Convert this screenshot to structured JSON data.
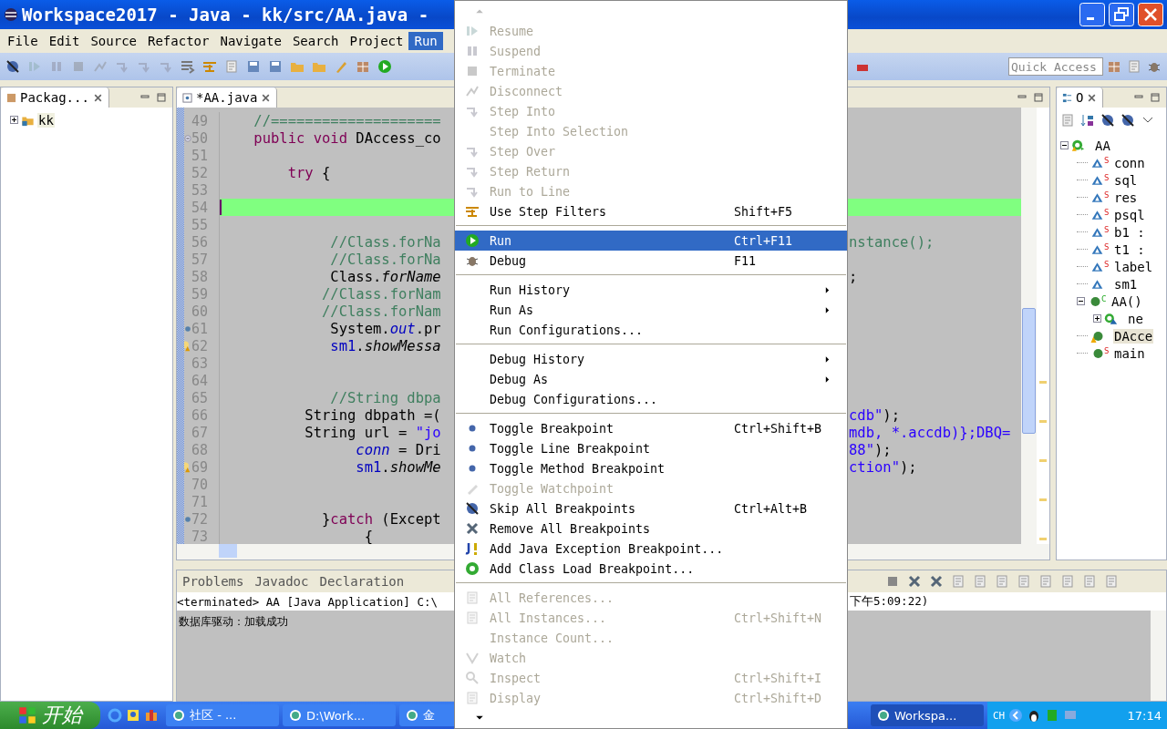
{
  "window": {
    "title": "Workspace2017 - Java - kk/src/AA.java -"
  },
  "menubar": [
    {
      "label": "File",
      "selected": false
    },
    {
      "label": "Edit",
      "selected": false
    },
    {
      "label": "Source",
      "selected": false
    },
    {
      "label": "Refactor",
      "selected": false
    },
    {
      "label": "Navigate",
      "selected": false
    },
    {
      "label": "Search",
      "selected": false
    },
    {
      "label": "Project",
      "selected": false
    },
    {
      "label": "Run",
      "selected": true
    }
  ],
  "toolbar": {
    "quick_access": {
      "placeholder": "Quick Access"
    }
  },
  "package_explorer": {
    "tab": {
      "label": "Packag..."
    },
    "tree": [
      {
        "label": "kk",
        "expanded": false,
        "selected": true
      }
    ]
  },
  "editor": {
    "tab": {
      "label": "*AA.java"
    },
    "lines": [
      {
        "number": "49",
        "kind": "plain",
        "highlighted": false,
        "left": [
          {
            "kind": "comment",
            "text": "    //===================="
          }
        ]
      },
      {
        "number": "50",
        "kind": "fold",
        "highlighted": false,
        "left": [
          {
            "kind": "keyword",
            "text": "    public void "
          },
          {
            "kind": "plain",
            "text": "DAccess_co"
          }
        ]
      },
      {
        "number": "51",
        "kind": "plain",
        "highlighted": false
      },
      {
        "number": "52",
        "kind": "plain",
        "highlighted": false,
        "left": [
          {
            "kind": "keyword",
            "text": "        try"
          },
          {
            "kind": "plain",
            "text": " {"
          }
        ]
      },
      {
        "number": "53",
        "kind": "plain",
        "highlighted": false
      },
      {
        "number": "54",
        "kind": "plain",
        "highlighted": true
      },
      {
        "number": "55",
        "kind": "plain",
        "highlighted": false
      },
      {
        "number": "56",
        "kind": "plain",
        "highlighted": false,
        "left": [
          {
            "kind": "comment",
            "text": "             //Class.forNa"
          }
        ],
        "right": [
          {
            "kind": "comment",
            "text": "nstance();"
          }
        ]
      },
      {
        "number": "57",
        "kind": "plain",
        "highlighted": false,
        "left": [
          {
            "kind": "comment",
            "text": "             //Class.forNa"
          }
        ]
      },
      {
        "number": "58",
        "kind": "plain",
        "highlighted": false,
        "left": [
          {
            "kind": "plain",
            "text": "             Class."
          },
          {
            "kind": "method",
            "text": "forName"
          }
        ],
        "right": [
          {
            "kind": "plain",
            "text": ";"
          }
        ]
      },
      {
        "number": "59",
        "kind": "plain",
        "highlighted": false,
        "left": [
          {
            "kind": "comment",
            "text": "            //Class.forNam"
          }
        ]
      },
      {
        "number": "60",
        "kind": "plain",
        "highlighted": false,
        "left": [
          {
            "kind": "comment",
            "text": "            //Class.forNam"
          }
        ]
      },
      {
        "number": "61",
        "kind": "dot",
        "highlighted": false,
        "left": [
          {
            "kind": "plain",
            "text": "             System."
          },
          {
            "kind": "static",
            "text": "out"
          },
          {
            "kind": "plain",
            "text": ".pr"
          }
        ]
      },
      {
        "number": "62",
        "kind": "warning",
        "highlighted": false,
        "left": [
          {
            "kind": "field",
            "text": "             sm1"
          },
          {
            "kind": "plain",
            "text": "."
          },
          {
            "kind": "method",
            "text": "showMessa"
          }
        ]
      },
      {
        "number": "63",
        "kind": "plain",
        "highlighted": false
      },
      {
        "number": "64",
        "kind": "plain",
        "highlighted": false
      },
      {
        "number": "65",
        "kind": "plain",
        "highlighted": false,
        "left": [
          {
            "kind": "comment",
            "text": "             //String dbpa"
          }
        ]
      },
      {
        "number": "66",
        "kind": "plain",
        "highlighted": false,
        "left": [
          {
            "kind": "plain",
            "text": "          String dbpath =("
          }
        ],
        "right": [
          {
            "kind": "string",
            "text": "cdb\""
          },
          {
            "kind": "plain",
            "text": ");"
          }
        ]
      },
      {
        "number": "67",
        "kind": "plain",
        "highlighted": false,
        "left": [
          {
            "kind": "plain",
            "text": "          String url = "
          },
          {
            "kind": "string",
            "text": "\"jo"
          }
        ],
        "right": [
          {
            "kind": "string",
            "text": "mdb, *.accdb)};DBQ="
          }
        ]
      },
      {
        "number": "68",
        "kind": "plain",
        "highlighted": false,
        "left": [
          {
            "kind": "static",
            "text": "                conn"
          },
          {
            "kind": "plain",
            "text": " = Dri"
          }
        ],
        "right": [
          {
            "kind": "string",
            "text": "88\""
          },
          {
            "kind": "plain",
            "text": ");"
          }
        ]
      },
      {
        "number": "69",
        "kind": "warning",
        "highlighted": false,
        "left": [
          {
            "kind": "field",
            "text": "                sm1"
          },
          {
            "kind": "plain",
            "text": "."
          },
          {
            "kind": "method",
            "text": "showMe"
          }
        ],
        "right": [
          {
            "kind": "string",
            "text": "ction\""
          },
          {
            "kind": "plain",
            "text": ");"
          }
        ]
      },
      {
        "number": "70",
        "kind": "plain",
        "highlighted": false
      },
      {
        "number": "71",
        "kind": "plain",
        "highlighted": false
      },
      {
        "number": "72",
        "kind": "dot",
        "highlighted": false,
        "left": [
          {
            "kind": "plain",
            "text": "            }"
          },
          {
            "kind": "keyword",
            "text": "catch"
          },
          {
            "kind": "plain",
            "text": " (Except"
          }
        ]
      },
      {
        "number": "73",
        "kind": "plain",
        "highlighted": false,
        "left": [
          {
            "kind": "plain",
            "text": "                 {"
          }
        ]
      }
    ]
  },
  "outline": {
    "tab": {
      "label": "O"
    },
    "tree": [
      {
        "kind": "class",
        "label": "AA",
        "warning": true,
        "expanded": true,
        "selected": false,
        "children": [
          {
            "kind": "field",
            "label": "conn",
            "badge": "S",
            "selected": false
          },
          {
            "kind": "field",
            "label": "sql",
            "badge": "S",
            "selected": false
          },
          {
            "kind": "field",
            "label": "res",
            "badge": "S",
            "selected": false
          },
          {
            "kind": "field",
            "label": "psql",
            "badge": "S",
            "selected": false
          },
          {
            "kind": "field",
            "label": "b1 :",
            "badge": "S",
            "selected": false
          },
          {
            "kind": "field",
            "label": "t1 :",
            "badge": "S",
            "selected": false
          },
          {
            "kind": "field",
            "label": "label",
            "badge": "S",
            "selected": false
          },
          {
            "kind": "field",
            "label": "sm1",
            "selected": false
          },
          {
            "kind": "constructor",
            "label": "AA()",
            "badge": "C",
            "expanded": true,
            "selected": false,
            "children": [
              {
                "kind": "anonymous",
                "label": "ne",
                "expanded": false,
                "selected": false
              }
            ]
          },
          {
            "kind": "method",
            "label": "DAcce",
            "warning": true,
            "selected": true
          },
          {
            "kind": "method",
            "label": "main",
            "badge": "S",
            "selected": false
          }
        ]
      }
    ]
  },
  "bottom_panel": {
    "tabs": [
      {
        "label": "Problems",
        "selected": false
      },
      {
        "label": "Javadoc",
        "selected": false
      },
      {
        "label": "Declaration",
        "selected": false
      }
    ],
    "console": {
      "status": [
        "<terminated> AA [Java Application] C:\\",
        "下午5:09:22)"
      ],
      "output": "数据库驱动：加载成功"
    }
  },
  "run_menu": [
    {
      "kind": "item",
      "label": "Resume",
      "disabled": true,
      "selected": false
    },
    {
      "kind": "item",
      "label": "Suspend",
      "disabled": true,
      "selected": false
    },
    {
      "kind": "item",
      "label": "Terminate",
      "disabled": true,
      "selected": false
    },
    {
      "kind": "item",
      "label": "Disconnect",
      "disabled": true,
      "selected": false
    },
    {
      "kind": "item",
      "label": "Step Into",
      "disabled": true,
      "selected": false
    },
    {
      "kind": "item",
      "label": "Step Into Selection",
      "disabled": true,
      "selected": false
    },
    {
      "kind": "item",
      "label": "Step Over",
      "disabled": true,
      "selected": false
    },
    {
      "kind": "item",
      "label": "Step Return",
      "disabled": true,
      "selected": false
    },
    {
      "kind": "item",
      "label": "Run to Line",
      "disabled": true,
      "selected": false
    },
    {
      "kind": "item",
      "label": "Use Step Filters",
      "shortcut": "Shift+F5",
      "disabled": false,
      "selected": false
    },
    {
      "kind": "separator"
    },
    {
      "kind": "item",
      "label": "Run",
      "shortcut": "Ctrl+F11",
      "disabled": false,
      "selected": true
    },
    {
      "kind": "item",
      "label": "Debug",
      "shortcut": "F11",
      "disabled": false,
      "selected": false
    },
    {
      "kind": "separator"
    },
    {
      "kind": "submenu",
      "label": "Run History",
      "disabled": false,
      "selected": false
    },
    {
      "kind": "submenu",
      "label": "Run As",
      "disabled": false,
      "selected": false
    },
    {
      "kind": "item",
      "label": "Run Configurations...",
      "disabled": false,
      "selected": false
    },
    {
      "kind": "separator"
    },
    {
      "kind": "submenu",
      "label": "Debug History",
      "disabled": false,
      "selected": false
    },
    {
      "kind": "submenu",
      "label": "Debug As",
      "disabled": false,
      "selected": false
    },
    {
      "kind": "item",
      "label": "Debug Configurations...",
      "disabled": false,
      "selected": false
    },
    {
      "kind": "separator"
    },
    {
      "kind": "item",
      "label": "Toggle Breakpoint",
      "shortcut": "Ctrl+Shift+B",
      "disabled": false,
      "selected": false
    },
    {
      "kind": "item",
      "label": "Toggle Line Breakpoint",
      "disabled": false,
      "selected": false
    },
    {
      "kind": "item",
      "label": "Toggle Method Breakpoint",
      "disabled": false,
      "selected": false
    },
    {
      "kind": "item",
      "label": "Toggle Watchpoint",
      "disabled": true,
      "selected": false
    },
    {
      "kind": "item",
      "label": "Skip All Breakpoints",
      "shortcut": "Ctrl+Alt+B",
      "disabled": false,
      "selected": false
    },
    {
      "kind": "item",
      "label": "Remove All Breakpoints",
      "disabled": false,
      "selected": false
    },
    {
      "kind": "item",
      "label": "Add Java Exception Breakpoint...",
      "disabled": false,
      "selected": false
    },
    {
      "kind": "item",
      "label": "Add Class Load Breakpoint...",
      "disabled": false,
      "selected": false
    },
    {
      "kind": "separator"
    },
    {
      "kind": "item",
      "label": "All References...",
      "disabled": true,
      "selected": false
    },
    {
      "kind": "item",
      "label": "All Instances...",
      "shortcut": "Ctrl+Shift+N",
      "disabled": true,
      "selected": false
    },
    {
      "kind": "item",
      "label": "Instance Count...",
      "disabled": true,
      "selected": false
    },
    {
      "kind": "item",
      "label": "Watch",
      "disabled": true,
      "selected": false
    },
    {
      "kind": "item",
      "label": "Inspect",
      "shortcut": "Ctrl+Shift+I",
      "disabled": true,
      "selected": false
    },
    {
      "kind": "item",
      "label": "Display",
      "shortcut": "Ctrl+Shift+D",
      "disabled": true,
      "selected": false
    }
  ],
  "taskbar": {
    "start": "开始",
    "tasks": [
      {
        "label": "社区 - ...",
        "selected": false
      },
      {
        "label": "D:\\Work...",
        "selected": false
      },
      {
        "label": "金",
        "selected": false
      },
      {
        "label": "Workspa...",
        "selected": true
      }
    ],
    "language": "CH",
    "clock": "17:14"
  }
}
